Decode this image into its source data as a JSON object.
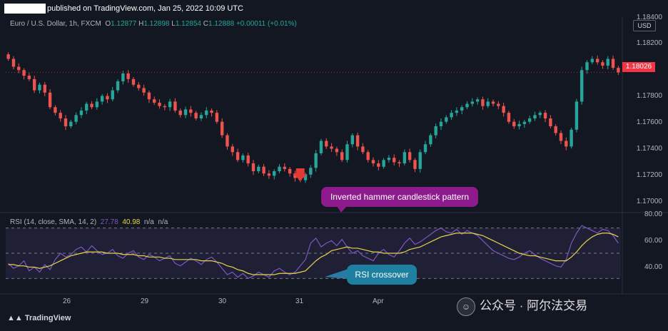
{
  "header": {
    "published": "published on TradingView.com, Jan 25, 2022 10:09 UTC"
  },
  "legend": {
    "symbol": "Euro / U.S. Dollar, 1h, FXCM",
    "o_label": "O",
    "o_value": "1.12877",
    "h_label": "H",
    "h_value": "1.12898",
    "l_label": "L",
    "l_value": "1.12854",
    "c_label": "C",
    "c_value": "1.12888",
    "change": "+0.00011 (+0.01%)"
  },
  "price_axis": {
    "currency": "USD",
    "last_price": "1.18026",
    "labels": [
      "1.18400",
      "1.18200",
      "1.17800",
      "1.17600",
      "1.17400",
      "1.17200",
      "1.17000"
    ]
  },
  "rsi": {
    "label": "RSI (14, close, SMA, 14, 2)",
    "rsi_value": "27.78",
    "ma_value": "40.98",
    "na1": "n/a",
    "na2": "n/a",
    "axis_labels": [
      "80.00",
      "60.00",
      "40.00"
    ]
  },
  "time_axis": [
    "26",
    "29",
    "30",
    "31",
    "Apr"
  ],
  "annotations": {
    "hammer": "Inverted hammer candlestick pattern",
    "crossover": "RSI crossover"
  },
  "branding": {
    "logo": "TradingView",
    "watermark": "公众号 · 阿尔法交易"
  },
  "colors": {
    "background": "#131722",
    "bull": "#26a69a",
    "bear": "#ef5350",
    "rsi_line": "#7e57c2",
    "rsi_ma": "#e8d44d",
    "callout_purple": "#8e1b8e",
    "callout_teal": "#1e7fa0",
    "last_price_badge": "#f23645"
  },
  "chart_data": {
    "type": "candlestick",
    "ylim": [
      1.1685,
      1.1845
    ],
    "closes": [
      1.1818,
      1.1811,
      1.1808,
      1.1803,
      1.18,
      1.179,
      1.1795,
      1.1788,
      1.1775,
      1.177,
      1.1765,
      1.1758,
      1.1762,
      1.1768,
      1.1772,
      1.1778,
      1.1775,
      1.178,
      1.1785,
      1.1782,
      1.179,
      1.1798,
      1.1805,
      1.18,
      1.1795,
      1.1792,
      1.1788,
      1.1782,
      1.1779,
      1.1776,
      1.1775,
      1.178,
      1.1772,
      1.1768,
      1.1773,
      1.177,
      1.1765,
      1.1768,
      1.1772,
      1.177,
      1.1762,
      1.175,
      1.174,
      1.1735,
      1.1728,
      1.1732,
      1.1725,
      1.1718,
      1.1722,
      1.1716,
      1.1714,
      1.1718,
      1.1722,
      1.172,
      1.1716,
      1.1712,
      1.171,
      1.1715,
      1.1721,
      1.1734,
      1.1745,
      1.174,
      1.1738,
      1.1735,
      1.1728,
      1.1742,
      1.175,
      1.174,
      1.1735,
      1.1728,
      1.1725,
      1.1722,
      1.1728,
      1.173,
      1.1726,
      1.1725,
      1.1735,
      1.1728,
      1.172,
      1.1735,
      1.1742,
      1.175,
      1.1758,
      1.1762,
      1.1766,
      1.177,
      1.1772,
      1.1775,
      1.1778,
      1.178,
      1.1782,
      1.1776,
      1.178,
      1.1778,
      1.1776,
      1.177,
      1.1762,
      1.1758,
      1.176,
      1.1762,
      1.1765,
      1.1768,
      1.177,
      1.1765,
      1.1758,
      1.1752,
      1.1745,
      1.174,
      1.1755,
      1.178,
      1.1808,
      1.1815,
      1.1818,
      1.1815,
      1.1812,
      1.1818,
      1.181,
      1.1806
    ],
    "rsi_ylim": [
      20,
      80
    ],
    "rsi_axis": [
      80,
      60,
      40
    ],
    "rsi_bands": [
      70,
      50,
      30
    ],
    "rsi": [
      42,
      38,
      40,
      44,
      36,
      39,
      35,
      41,
      37,
      45,
      50,
      47,
      49,
      53,
      55,
      51,
      56,
      52,
      49,
      50,
      53,
      48,
      46,
      50,
      52,
      47,
      45,
      49,
      47,
      44,
      46,
      48,
      42,
      40,
      43,
      46,
      44,
      41,
      45,
      47,
      43,
      38,
      33,
      35,
      31,
      34,
      30,
      32,
      35,
      33,
      31,
      36,
      38,
      35,
      33,
      35,
      40,
      45,
      58,
      62,
      55,
      58,
      60,
      56,
      61,
      55,
      50,
      52,
      48,
      46,
      44,
      50,
      53,
      49,
      47,
      52,
      58,
      62,
      57,
      59,
      62,
      65,
      68,
      70,
      67,
      66,
      69,
      65,
      68,
      66,
      64,
      60,
      56,
      52,
      50,
      48,
      46,
      45,
      47,
      50,
      52,
      49,
      46,
      44,
      42,
      40,
      39,
      45,
      58,
      66,
      72,
      70,
      68,
      66,
      69,
      68,
      64,
      58
    ],
    "rsi_ma": [
      41,
      41,
      40,
      40,
      39,
      39,
      38,
      39,
      40,
      42,
      44,
      46,
      48,
      49,
      50,
      51,
      51,
      51,
      51,
      50,
      50,
      50,
      49,
      49,
      49,
      48,
      48,
      47,
      47,
      47,
      46,
      46,
      45,
      45,
      45,
      45,
      45,
      44,
      44,
      44,
      43,
      42,
      40,
      39,
      37,
      36,
      34,
      33,
      33,
      33,
      33,
      33,
      34,
      34,
      34,
      34,
      35,
      36,
      40,
      44,
      47,
      49,
      52,
      53,
      54,
      55,
      54,
      54,
      53,
      52,
      51,
      51,
      50,
      50,
      50,
      50,
      51,
      53,
      54,
      55,
      57,
      59,
      61,
      63,
      64,
      65,
      66,
      66,
      66,
      66,
      65,
      64,
      62,
      60,
      58,
      56,
      54,
      52,
      50,
      49,
      48,
      48,
      47,
      46,
      45,
      44,
      44,
      44,
      47,
      51,
      56,
      60,
      63,
      65,
      66,
      66,
      65,
      63
    ]
  }
}
